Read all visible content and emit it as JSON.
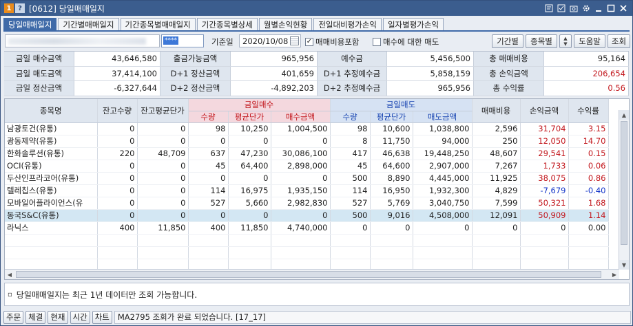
{
  "window": {
    "badge_1": "1",
    "badge_help": "?",
    "title": "[0612] 당일매매일지",
    "icons": [
      "memo-icon",
      "check-icon",
      "camera-icon",
      "gear-icon",
      "minimize-icon",
      "maximize-icon",
      "close-icon"
    ]
  },
  "tabs": [
    "당일매매일지",
    "기간별매매일지",
    "기간종목별매매일지",
    "기간종목별상세",
    "월별손익현황",
    "전일대비평가손익",
    "일자별평가손익"
  ],
  "toolbar": {
    "password_mask": "****",
    "date_label": "기준일",
    "date_value": "2020/10/08",
    "fee_include_label": "매매비용포함",
    "fee_include_checked": "✓",
    "sell_on_buy_label": "매수에 대한 매도",
    "btn_period": "기간별",
    "btn_stock": "종목별",
    "btn_help": "도움말",
    "btn_query": "조회"
  },
  "summary": {
    "rows": [
      [
        {
          "label": "금일 매수금액",
          "value": "43,646,580",
          "color": ""
        },
        {
          "label": "출금가능금액",
          "value": "965,956",
          "color": ""
        },
        {
          "label": "예수금",
          "value": "5,456,500",
          "color": ""
        },
        {
          "label": "총 매매비용",
          "value": "95,164",
          "color": ""
        }
      ],
      [
        {
          "label": "금일 매도금액",
          "value": "37,414,100",
          "color": ""
        },
        {
          "label": "D+1 정산금액",
          "value": "401,659",
          "color": ""
        },
        {
          "label": "D+1 추정예수금",
          "value": "5,858,159",
          "color": ""
        },
        {
          "label": "총 손익금액",
          "value": "206,654",
          "color": "red"
        }
      ],
      [
        {
          "label": "금일 정산금액",
          "value": "-6,327,644",
          "color": ""
        },
        {
          "label": "D+2 정산금액",
          "value": "-4,892,203",
          "color": ""
        },
        {
          "label": "D+2 추정예수금",
          "value": "965,956",
          "color": ""
        },
        {
          "label": "총 수익률",
          "value": "0.56",
          "color": "red"
        }
      ]
    ]
  },
  "table": {
    "headers": {
      "name": "종목명",
      "hold_qty": "잔고수량",
      "hold_avg": "잔고평균단가",
      "buy_group": "금일매수",
      "sell_group": "금일매도",
      "qty": "수량",
      "avg": "평균단가",
      "buy_amt": "매수금액",
      "sell_amt": "매도금액",
      "fee": "매매비용",
      "pnl": "손익금액",
      "rate": "수익률"
    },
    "rows": [
      {
        "name": "남광토건(유통)",
        "hq": "0",
        "ha": "0",
        "bq": "98",
        "ba": "10,250",
        "bm": "1,004,500",
        "sq": "98",
        "sa": "10,600",
        "sm": "1,038,800",
        "fee": "2,596",
        "pnl": "31,704",
        "rate": "3.15",
        "color": "red"
      },
      {
        "name": "광동제약(유통)",
        "hq": "0",
        "ha": "0",
        "bq": "0",
        "ba": "0",
        "bm": "0",
        "sq": "8",
        "sa": "11,750",
        "sm": "94,000",
        "fee": "250",
        "pnl": "12,050",
        "rate": "14.70",
        "color": "red"
      },
      {
        "name": "한화솔루션(유통)",
        "hq": "220",
        "ha": "48,709",
        "bq": "637",
        "ba": "47,230",
        "bm": "30,086,100",
        "sq": "417",
        "sa": "46,638",
        "sm": "19,448,250",
        "fee": "48,607",
        "pnl": "29,541",
        "rate": "0.15",
        "color": "red"
      },
      {
        "name": "OCI(유통)",
        "hq": "0",
        "ha": "0",
        "bq": "45",
        "ba": "64,400",
        "bm": "2,898,000",
        "sq": "45",
        "sa": "64,600",
        "sm": "2,907,000",
        "fee": "7,267",
        "pnl": "1,733",
        "rate": "0.06",
        "color": "red"
      },
      {
        "name": "두산인프라코어(유통)",
        "hq": "0",
        "ha": "0",
        "bq": "0",
        "ba": "0",
        "bm": "0",
        "sq": "500",
        "sa": "8,890",
        "sm": "4,445,000",
        "fee": "11,925",
        "pnl": "38,075",
        "rate": "0.86",
        "color": "red"
      },
      {
        "name": "텔레칩스(유통)",
        "hq": "0",
        "ha": "0",
        "bq": "114",
        "ba": "16,975",
        "bm": "1,935,150",
        "sq": "114",
        "sa": "16,950",
        "sm": "1,932,300",
        "fee": "4,829",
        "pnl": "-7,679",
        "rate": "-0.40",
        "color": "blue"
      },
      {
        "name": "모바일어플라이언스(유",
        "hq": "0",
        "ha": "0",
        "bq": "527",
        "ba": "5,660",
        "bm": "2,982,830",
        "sq": "527",
        "sa": "5,769",
        "sm": "3,040,750",
        "fee": "7,599",
        "pnl": "50,321",
        "rate": "1.68",
        "color": "red"
      },
      {
        "name": "동국S&C(유통)",
        "hq": "0",
        "ha": "0",
        "bq": "0",
        "ba": "0",
        "bm": "0",
        "sq": "500",
        "sa": "9,016",
        "sm": "4,508,000",
        "fee": "12,091",
        "pnl": "50,909",
        "rate": "1.14",
        "color": "red",
        "selected": true
      },
      {
        "name": "라닉스",
        "hq": "400",
        "ha": "11,850",
        "bq": "400",
        "ba": "11,850",
        "bm": "4,740,000",
        "sq": "0",
        "sa": "0",
        "sm": "0",
        "fee": "0",
        "pnl": "0",
        "rate": "0.00",
        "color": ""
      }
    ]
  },
  "notice": "당일매매일지는 최근 1년 데이터만 조회 가능합니다.",
  "statusbar": {
    "buttons": [
      "주문",
      "체결",
      "현재",
      "시간",
      "차트"
    ],
    "message": "MA2795 조회가 완료 되었습니다. [17_17]"
  },
  "colors": {
    "accent": "#3f6aa8",
    "title_bg": "#3b5d8e",
    "profit": "#c2161c",
    "loss": "#1234c8"
  }
}
